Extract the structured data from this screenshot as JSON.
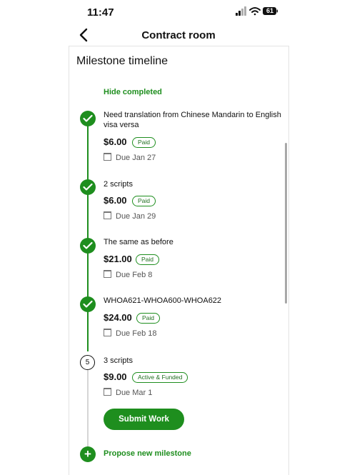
{
  "status_bar": {
    "time": "11:47",
    "battery": "61"
  },
  "header": {
    "title": "Contract room",
    "back_icon": "chevron-left-icon"
  },
  "section": {
    "title": "Milestone timeline",
    "toggle_label": "Hide completed"
  },
  "milestones": [
    {
      "title": "Need translation from Chinese Mandarin to English visa versa",
      "amount": "$6.00",
      "status": "Paid",
      "due": "Due Jan 27",
      "completed": true
    },
    {
      "title": "2 scripts",
      "amount": "$6.00",
      "status": "Paid",
      "due": "Due Jan 29",
      "completed": true
    },
    {
      "title": "The same as before",
      "amount": "$21.00",
      "status": "Paid",
      "due": "Due Feb 8",
      "completed": true
    },
    {
      "title": "WHOA621-WHOA600-WHOA622",
      "amount": "$24.00",
      "status": "Paid",
      "due": "Due Feb 18",
      "completed": true
    },
    {
      "number": "5",
      "title": "3 scripts",
      "amount": "$9.00",
      "status": "Active & Funded",
      "due": "Due Mar 1",
      "completed": false
    }
  ],
  "actions": {
    "submit_label": "Submit Work",
    "propose_label": "Propose new milestone"
  },
  "colors": {
    "accent": "#1e8e1e"
  }
}
